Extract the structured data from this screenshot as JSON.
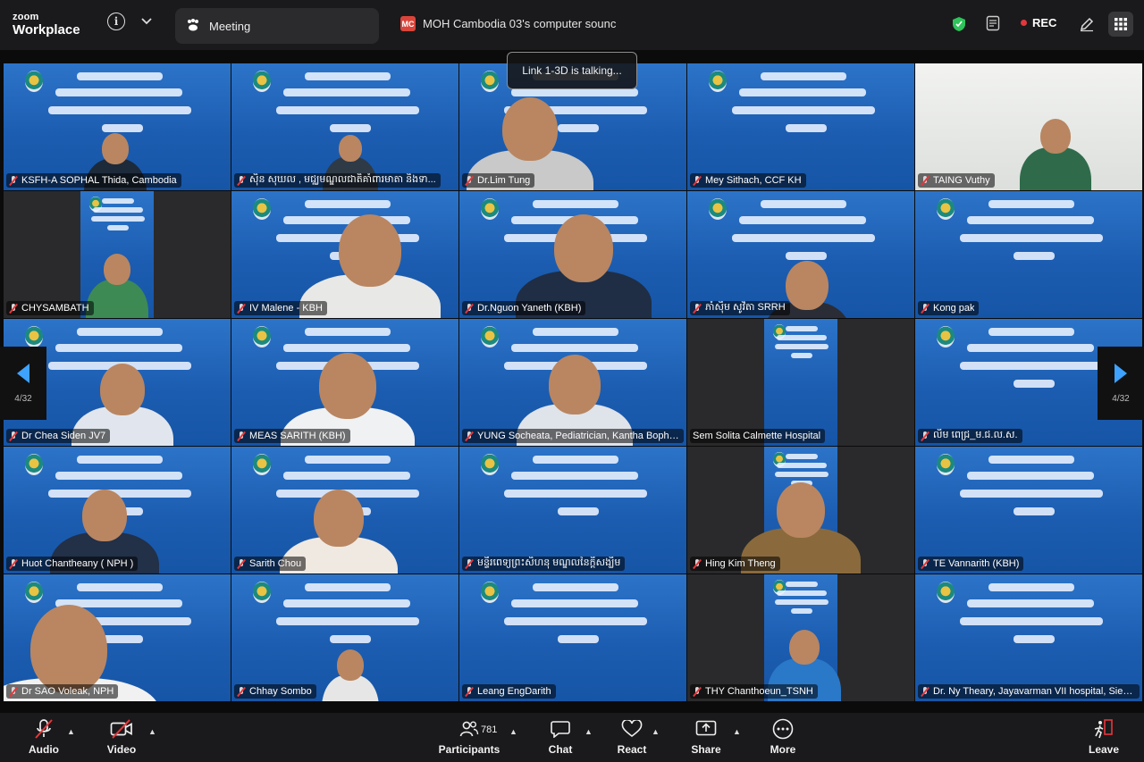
{
  "app": {
    "brand_top": "zoom",
    "brand_bottom": "Workplace"
  },
  "tabs": {
    "meeting": "Meeting",
    "share_badge": "MC",
    "share_title": "MOH Cambodia 03's computer sounc"
  },
  "status": {
    "rec_label": "REC"
  },
  "talking_toast": "Link 1-3D is talking...",
  "pager": {
    "left": "4/32",
    "right": "4/32"
  },
  "participants": [
    {
      "name": "KSFH-A SOPHAL Thida, Cambodia",
      "muted": true
    },
    {
      "name": "ស៊ិន សុឃល , មជ្ឈមណ្ឌលជាតិគាំពារមាតា និងទា...",
      "muted": true
    },
    {
      "name": "Dr.Lim Tung",
      "muted": true
    },
    {
      "name": "Mey Sithach, CCF KH",
      "muted": true
    },
    {
      "name": "TAING Vuthy",
      "muted": true
    },
    {
      "name": "CHYSAMBATH",
      "muted": true
    },
    {
      "name": "IV Malene - KBH",
      "muted": true
    },
    {
      "name": "Dr.Nguon Yaneth (KBH)",
      "muted": true
    },
    {
      "name": "ភាំស៊ឹម សូវិតា SRRH",
      "muted": true
    },
    {
      "name": "Kong pak",
      "muted": true
    },
    {
      "name": "Dr Chea Siden JV7",
      "muted": true
    },
    {
      "name": "MEAS SARITH (KBH)",
      "muted": true
    },
    {
      "name": "YUNG Socheata, Pediatrician, Kantha Bopha ...",
      "muted": true
    },
    {
      "name": "Sem Solita Calmette Hospital",
      "muted": false
    },
    {
      "name": "លឹម ពេជ្រ_ម.ជ.ល.ស.",
      "muted": true
    },
    {
      "name": "Huot Chantheany ( NPH )",
      "muted": true
    },
    {
      "name": "Sarith Chou",
      "muted": true
    },
    {
      "name": "មន្ទីរពេទ្យព្រះសិហនុ មណ្ឌលនៃក្តីសង្ឃឹម",
      "muted": true
    },
    {
      "name": "Hing Kim Theng",
      "muted": true
    },
    {
      "name": "TE Vannarith (KBH)",
      "muted": true
    },
    {
      "name": "Dr SAO Voleak, NPH",
      "muted": true
    },
    {
      "name": "Chhay Sombo",
      "muted": true
    },
    {
      "name": "Leang EngDarith",
      "muted": true
    },
    {
      "name": "THY Chanthoeun_TSNH",
      "muted": true
    },
    {
      "name": "Dr. Ny Theary, Jayavarman VII hospital, Siem ...",
      "muted": true
    }
  ],
  "toolbar": {
    "audio": "Audio",
    "video": "Video",
    "participants": "Participants",
    "participant_count": "781",
    "chat": "Chat",
    "react": "React",
    "share": "Share",
    "more": "More",
    "leave": "Leave"
  },
  "colors": {
    "accent": "#3ea2ff",
    "rec": "#e0383e",
    "slide_blue": "#1c5db1",
    "secure": "#2fc35b",
    "mute_red": "#e5373c"
  }
}
